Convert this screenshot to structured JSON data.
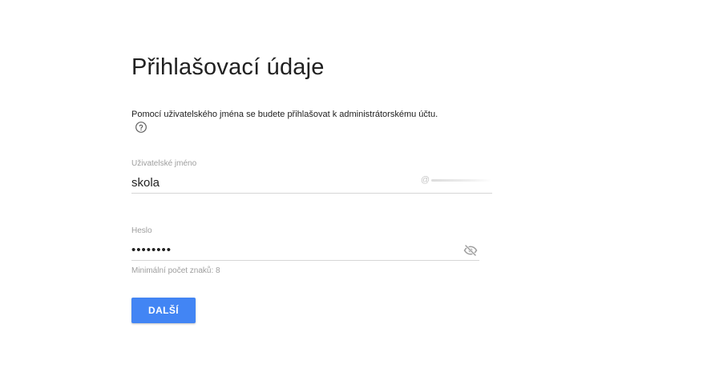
{
  "page": {
    "title": "Přihlašovací údaje",
    "description": "Pomocí uživatelského jména se budete přihlašovat k administrátorskému účtu.",
    "help_icon": "help-circle-icon"
  },
  "username": {
    "label": "Uživatelské jméno",
    "value": "skola",
    "domain_prefix": "@"
  },
  "password": {
    "label": "Heslo",
    "value": "skola123",
    "visibility_icon": "eye-off-icon",
    "hint": "Minimální počet znaků: 8"
  },
  "actions": {
    "next_label": "DALŠÍ"
  },
  "colors": {
    "accent": "#4285f4",
    "text_primary": "#212121",
    "text_secondary": "#9e9e9e",
    "divider": "#d6d6d6"
  }
}
